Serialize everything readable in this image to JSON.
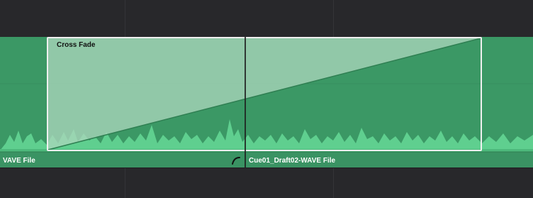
{
  "crossfade": {
    "label": "Cross Fade"
  },
  "clips": {
    "left_name": "VAVE File",
    "right_name": "Cue01_Draft02-WAVE File"
  },
  "colors": {
    "clip": "#3b9865",
    "waveform": "#5fcf8f",
    "fade_overlay": "#a9d6bb",
    "crossfade_border": "#f0f0f0"
  },
  "icons": {
    "fade_handle": "fade-curve-icon"
  }
}
